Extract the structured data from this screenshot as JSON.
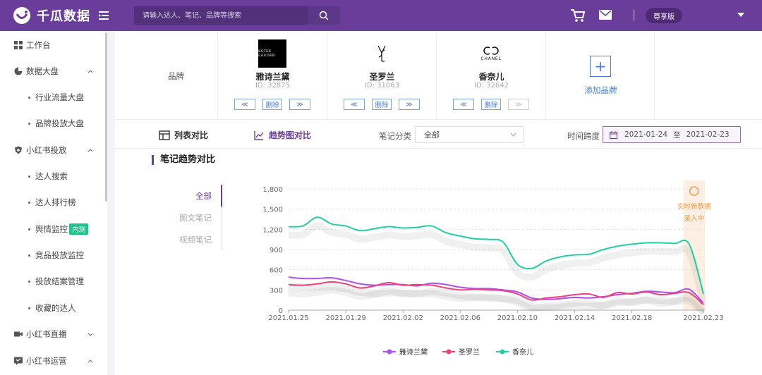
{
  "app": {
    "name": "千瓜数据"
  },
  "search": {
    "placeholder": "请输入达人、笔记、品牌等搜索"
  },
  "header": {
    "edition": "尊享版"
  },
  "sidebar": {
    "items": [
      {
        "label": "工作台"
      },
      {
        "label": "数据大盘"
      },
      {
        "label": "行业流量大盘"
      },
      {
        "label": "品牌投放大盘"
      },
      {
        "label": "小红书投放"
      },
      {
        "label": "达人搜索"
      },
      {
        "label": "达人排行榜"
      },
      {
        "label": "舆情监控",
        "badge": "内测"
      },
      {
        "label": "竞品投放监控"
      },
      {
        "label": "投放结案管理"
      },
      {
        "label": "收藏的达人"
      },
      {
        "label": "小红书直播"
      },
      {
        "label": "小红书运营"
      }
    ]
  },
  "brands": {
    "label": "品牌",
    "list": [
      {
        "name": "雅诗兰黛",
        "id": "ID:  32875",
        "logo_text": "ESTEE LAUDER"
      },
      {
        "name": "圣罗兰",
        "id": "ID:  31063",
        "logo_text": "YSL"
      },
      {
        "name": "香奈儿",
        "id": "ID:  32642",
        "logo_text": "CHANEL"
      }
    ],
    "actions": {
      "prev": "≪",
      "delete": "删除",
      "next": "≫"
    },
    "add_label": "添加品牌"
  },
  "filters": {
    "tab_list": "列表对比",
    "tab_trend": "趋势图对比",
    "category_label": "笔记分类",
    "category_value": "全部",
    "time_label": "时间跨度",
    "date_start": "2021-01-24",
    "date_sep": "至",
    "date_end": "2021-02-23"
  },
  "section": {
    "title": "笔记趋势对比"
  },
  "sub_tabs": [
    "全部",
    "图文笔记",
    "视频笔记"
  ],
  "colors": {
    "brand": "#6a3d9a",
    "estee": "#b04ef0",
    "ysl": "#f0427a",
    "chanel": "#22cfa4",
    "highlight": "#f2994a"
  },
  "chart_data": {
    "type": "line",
    "title": "",
    "xlabel": "",
    "ylabel": "",
    "ylim": [
      0,
      1800
    ],
    "yticks": [
      0,
      300,
      600,
      900,
      1200,
      1500,
      1800
    ],
    "ytick_labels": [
      "0",
      "300",
      "600",
      "900",
      "1,200",
      "1,500",
      "1,800"
    ],
    "x": [
      "2021.01.25",
      "2021.01.26",
      "2021.01.27",
      "2021.01.28",
      "2021.01.29",
      "2021.01.30",
      "2021.01.31",
      "2021.02.01",
      "2021.02.02",
      "2021.02.03",
      "2021.02.04",
      "2021.02.05",
      "2021.02.06",
      "2021.02.07",
      "2021.02.08",
      "2021.02.09",
      "2021.02.10",
      "2021.02.11",
      "2021.02.12",
      "2021.02.13",
      "2021.02.14",
      "2021.02.15",
      "2021.02.16",
      "2021.02.17",
      "2021.02.18",
      "2021.02.19",
      "2021.02.20",
      "2021.02.21",
      "2021.02.22",
      "2021.02.23"
    ],
    "xtick_labels": [
      "2021.01.25",
      "2021.01.29",
      "2021.02.02",
      "2021.02.06",
      "2021.02.10",
      "2021.02.14",
      "2021.02.18",
      "2021.02.23"
    ],
    "series": [
      {
        "name": "雅诗兰黛",
        "values": [
          490,
          470,
          470,
          480,
          440,
          390,
          370,
          380,
          380,
          360,
          400,
          380,
          340,
          320,
          320,
          300,
          270,
          180,
          160,
          170,
          190,
          180,
          200,
          230,
          250,
          280,
          270,
          260,
          310,
          100
        ]
      },
      {
        "name": "圣罗兰",
        "values": [
          380,
          370,
          390,
          420,
          390,
          330,
          360,
          410,
          370,
          380,
          370,
          330,
          300,
          310,
          300,
          290,
          240,
          150,
          180,
          200,
          230,
          240,
          190,
          260,
          240,
          270,
          230,
          250,
          260,
          80
        ]
      },
      {
        "name": "香奈儿",
        "values": [
          1240,
          1250,
          1380,
          1280,
          1250,
          1180,
          1210,
          1240,
          1220,
          1230,
          1250,
          1150,
          1100,
          1060,
          1050,
          1010,
          680,
          620,
          730,
          790,
          820,
          830,
          900,
          950,
          980,
          1000,
          1000,
          990,
          980,
          240
        ]
      }
    ],
    "highlight": {
      "label_line1": "实时新数据",
      "label_line2": "录入中"
    }
  }
}
